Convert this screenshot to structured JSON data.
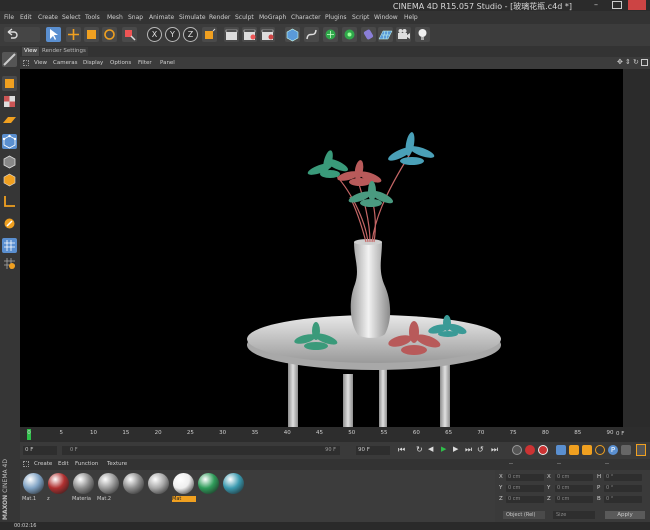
{
  "window": {
    "title": "CINEMA 4D R15.057 Studio - [玻璃花瓶.c4d *]"
  },
  "menubar": [
    "File",
    "Edit",
    "Create",
    "Select",
    "Tools",
    "Mesh",
    "Snap",
    "Animate",
    "Simulate",
    "Render",
    "Sculpt",
    "MoGraph",
    "Character",
    "Plugins",
    "Script",
    "Window",
    "Help"
  ],
  "toolbar": {
    "axis_x": "X",
    "axis_y": "Y",
    "axis_z": "Z"
  },
  "viewport": {
    "tabs": [
      "View",
      "Render Settings"
    ],
    "menu": [
      "View",
      "Cameras",
      "Display",
      "Options",
      "Filter",
      "Panel"
    ]
  },
  "timeline": {
    "ticks": [
      "0",
      "5",
      "10",
      "15",
      "20",
      "25",
      "30",
      "35",
      "40",
      "45",
      "50",
      "55",
      "60",
      "65",
      "70",
      "75",
      "80",
      "85",
      "90"
    ],
    "end_label": "0 F",
    "current_frame": "0 F",
    "start_field": "0 F",
    "range_field": "0 F",
    "end_range": "90 F",
    "end_field": "90 F"
  },
  "material_manager": {
    "menu": [
      "Create",
      "Edit",
      "Function",
      "Texture"
    ],
    "materials": [
      {
        "name": "Mat.1",
        "color": "#7fa2c4"
      },
      {
        "name": "z",
        "color": "#b03030"
      },
      {
        "name": "Materia",
        "color": "#8c8c8c"
      },
      {
        "name": "Mat.2",
        "color": "#9a9a9a"
      },
      {
        "name": "",
        "color": "#8d8d8d"
      },
      {
        "name": "",
        "color": "#a8a8a8"
      },
      {
        "name": "Mat",
        "color": "#eeeeee"
      },
      {
        "name": "",
        "color": "#2f9c5a"
      },
      {
        "name": "",
        "color": "#3a9ab0"
      }
    ],
    "selected_index": 6
  },
  "coordinates": {
    "header": "--",
    "rows": [
      {
        "axis": "X",
        "pos": "0 cm",
        "axis2": "X",
        "size": "0 cm",
        "axis3": "H",
        "rot": "0 °"
      },
      {
        "axis": "Y",
        "pos": "0 cm",
        "axis2": "Y",
        "size": "0 cm",
        "axis3": "P",
        "rot": "0 °"
      },
      {
        "axis": "Z",
        "pos": "0 cm",
        "axis2": "Z",
        "size": "0 cm",
        "axis3": "B",
        "rot": "0 °"
      }
    ],
    "mode_select": "Object (Rel)",
    "size_select": "Size",
    "apply_label": "Apply"
  },
  "statusbar": {
    "time": "00:02:16"
  },
  "brand": {
    "line1": "MAXON",
    "line2": "CINEMA 4D"
  },
  "colors": {
    "accent": "#f0a020",
    "highlight": "#5a8fd0",
    "viewport_bg": "#000000"
  }
}
